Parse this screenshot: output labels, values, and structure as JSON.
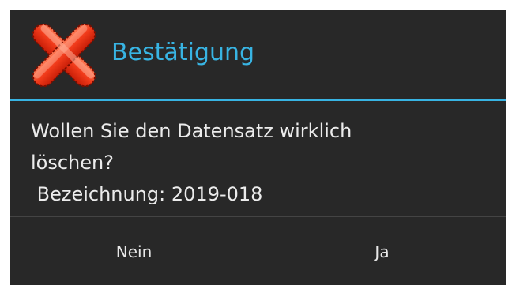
{
  "dialog": {
    "title": "Bestätigung",
    "icon": "close-x-icon",
    "accent_color": "#38b4e3",
    "message_lines": [
      "Wollen Sie den Datensatz wirklich",
      "löschen?",
      " Bezeichnung: 2019-018"
    ],
    "buttons": {
      "no_label": "Nein",
      "yes_label": "Ja"
    }
  }
}
